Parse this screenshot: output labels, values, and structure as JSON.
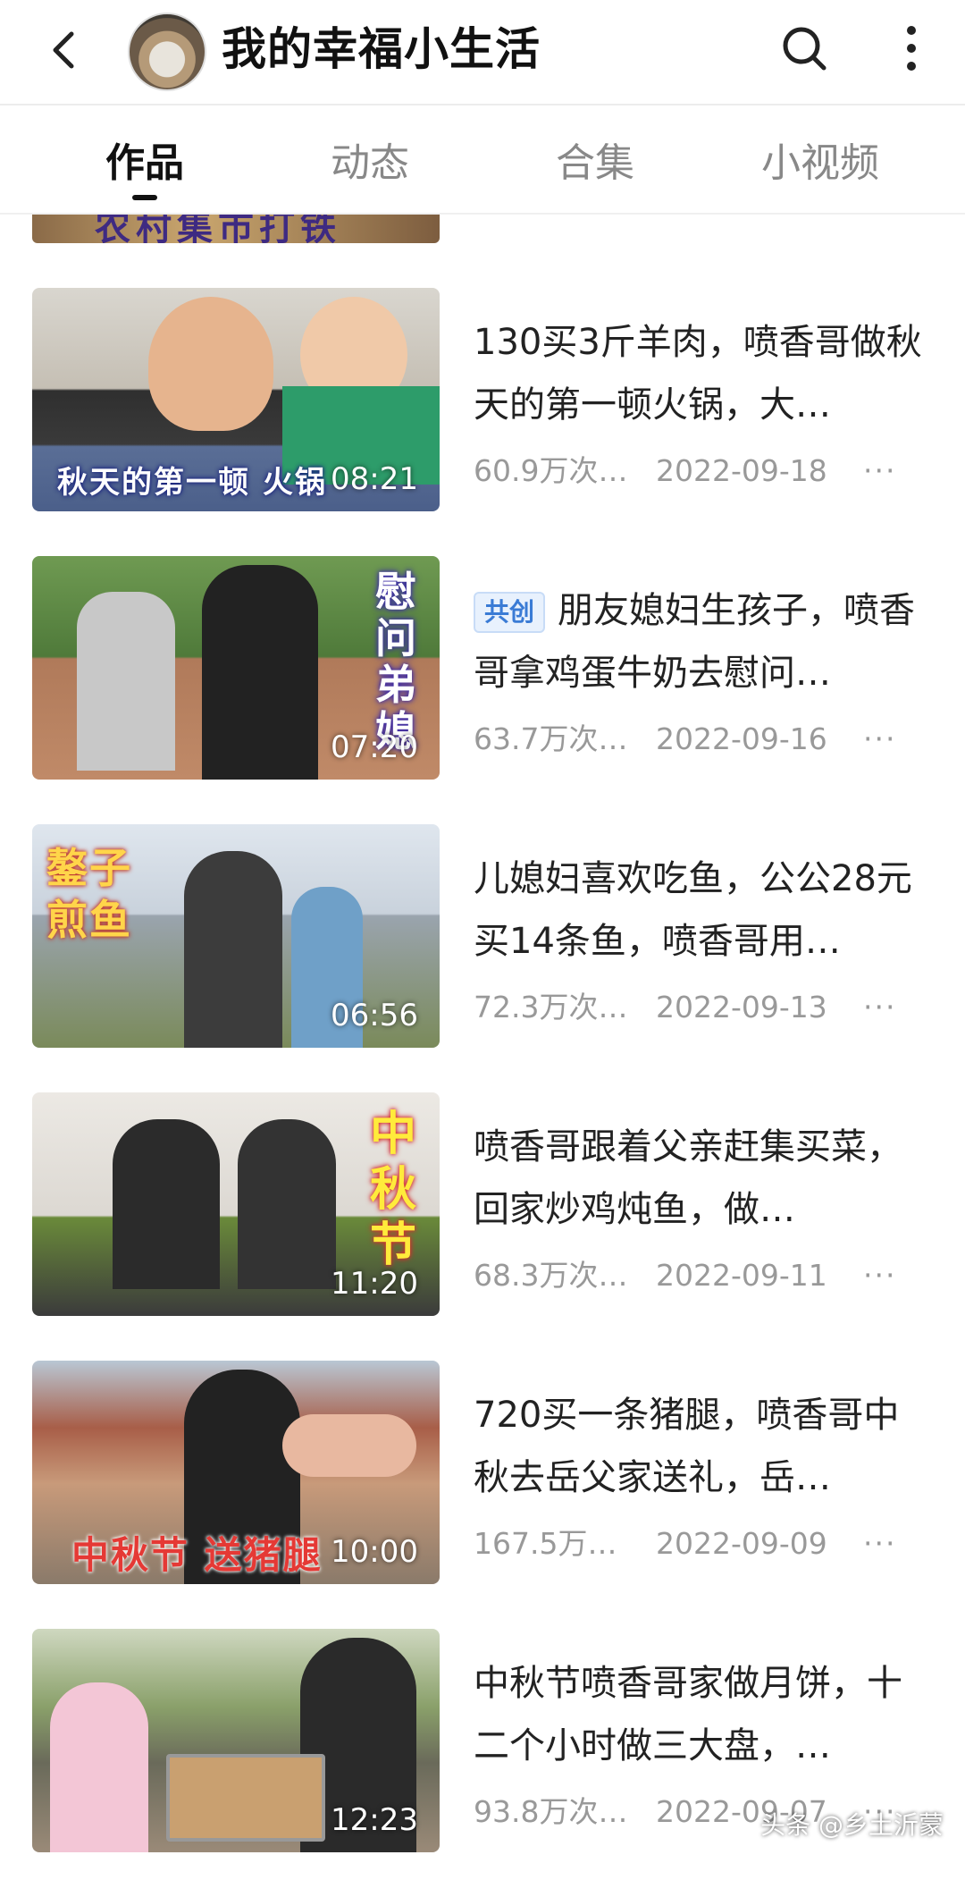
{
  "header": {
    "title": "我的幸福小生活",
    "back_icon": "chevron-left-icon",
    "search_icon": "search-icon",
    "more_icon": "more-vertical-icon"
  },
  "tabs": [
    {
      "label": "作品",
      "active": true
    },
    {
      "label": "动态",
      "active": false
    },
    {
      "label": "合集",
      "active": false
    },
    {
      "label": "小视频",
      "active": false
    }
  ],
  "partial_thumb_caption": "农村集市打铁",
  "videos": [
    {
      "title": "130买3斤羊肉，喷香哥做秋天的第一顿火锅，大…",
      "views": "60.9万次…",
      "date": "2022-09-18",
      "more": "···",
      "duration": "08:21",
      "caption": "秋天的第一顿 火锅",
      "badge": ""
    },
    {
      "title": "朋友媳妇生孩子，喷香哥拿鸡蛋牛奶去慰问…",
      "views": "63.7万次…",
      "date": "2022-09-16",
      "more": "···",
      "duration": "07:20",
      "caption": "慰问弟媳",
      "badge": "共创"
    },
    {
      "title": "儿媳妇喜欢吃鱼，公公28元买14条鱼，喷香哥用…",
      "views": "72.3万次…",
      "date": "2022-09-13",
      "more": "···",
      "duration": "06:56",
      "caption": "鏊子 煎鱼",
      "badge": ""
    },
    {
      "title": "喷香哥跟着父亲赶集买菜，回家炒鸡炖鱼，做…",
      "views": "68.3万次…",
      "date": "2022-09-11",
      "more": "···",
      "duration": "11:20",
      "caption": "中秋节",
      "badge": ""
    },
    {
      "title": "720买一条猪腿，喷香哥中秋去岳父家送礼，岳…",
      "views": "167.5万…",
      "date": "2022-09-09",
      "more": "···",
      "duration": "10:00",
      "caption": "中秋节 送猪腿",
      "badge": ""
    },
    {
      "title": "中秋节喷香哥家做月饼，十二个小时做三大盘，…",
      "views": "93.8万次…",
      "date": "2022-09-07",
      "more": "···",
      "duration": "12:23",
      "caption": "",
      "badge": ""
    }
  ],
  "watermark": "头条 @乡土沂蒙"
}
